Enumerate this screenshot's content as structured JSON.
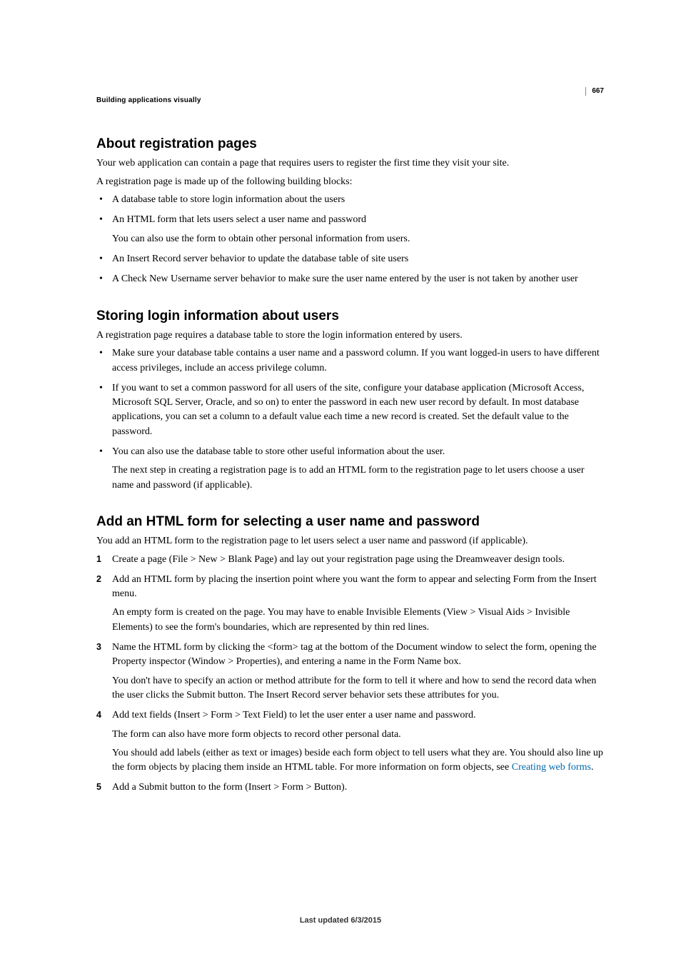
{
  "page": {
    "number": "667",
    "header": "Building applications visually",
    "footer": "Last updated 6/3/2015"
  },
  "sections": {
    "s1": {
      "title": "About registration pages",
      "p1": "Your web application can contain a page that requires users to register the first time they visit your site.",
      "p2": "A registration page is made up of the following building blocks:",
      "b1": "A database table to store login information about the users",
      "b2": "An HTML form that lets users select a user name and password",
      "b2sub": "You can also use the form to obtain other personal information from users.",
      "b3": "An Insert Record server behavior to update the database table of site users",
      "b4": "A Check New Username server behavior to make sure the user name entered by the user is not taken by another user"
    },
    "s2": {
      "title": "Storing login information about users",
      "p1": "A registration page requires a database table to store the login information entered by users.",
      "b1": "Make sure your database table contains a user name and a password column. If you want logged-in users to have different access privileges, include an access privilege column.",
      "b2": "If you want to set a common password for all users of the site, configure your database application (Microsoft Access, Microsoft SQL Server, Oracle, and so on) to enter the password in each new user record by default. In most database applications, you can set a column to a default value each time a new record is created. Set the default value to the password.",
      "b3": "You can also use the database table to store other useful information about the user.",
      "b3sub": "The next step in creating a registration page is to add an HTML form to the registration page to let users choose a user name and password (if applicable)."
    },
    "s3": {
      "title": "Add an HTML form for selecting a user name and password",
      "p1": "You add an HTML form to the registration page to let users select a user name and password (if applicable).",
      "n1": "Create a page (File > New > Blank Page) and lay out your registration page using the Dreamweaver design tools.",
      "n2": "Add an HTML form by placing the insertion point where you want the form to appear and selecting Form from the Insert menu.",
      "n2sub": "An empty form is created on the page. You may have to enable Invisible Elements (View > Visual Aids > Invisible Elements) to see the form's boundaries, which are represented by thin red lines.",
      "n3": "Name the HTML form by clicking the <form> tag at the bottom of the Document window to select the form, opening the Property inspector (Window > Properties), and entering a name in the Form Name box.",
      "n3sub": "You don't have to specify an action or method attribute for the form to tell it where and how to send the record data when the user clicks the Submit button. The Insert Record server behavior sets these attributes for you.",
      "n4": "Add text fields (Insert > Form > Text Field) to let the user enter a user name and password.",
      "n4sub1": "The form can also have more form objects to record other personal data.",
      "n4sub2a": "You should add labels (either as text or images) beside each form object to tell users what they are. You should also line up the form objects by placing them inside an HTML table. For more information on form objects, see ",
      "n4link": "Creating web forms",
      "n4sub2b": ".",
      "n5": "Add a Submit button to the form (Insert > Form > Button)."
    }
  }
}
